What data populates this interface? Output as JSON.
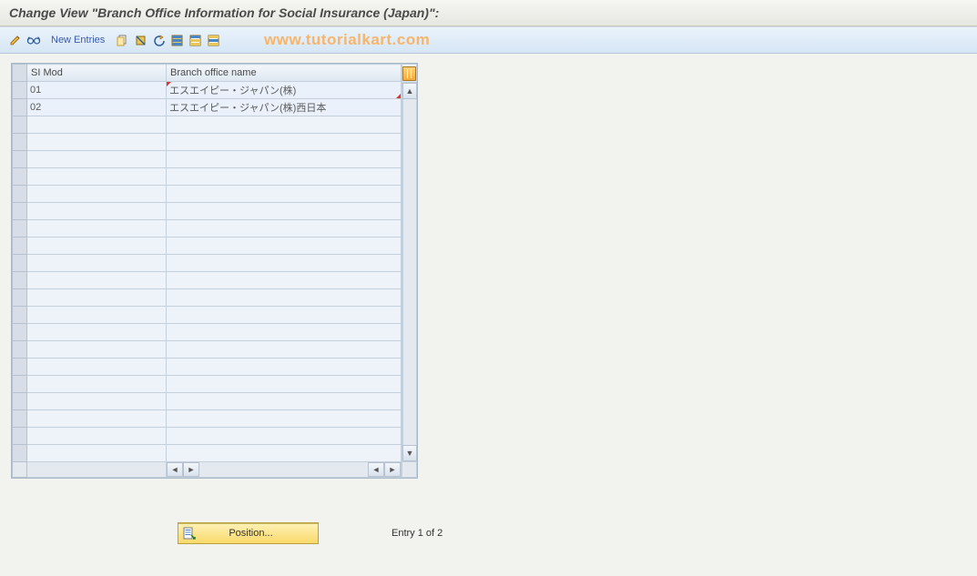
{
  "title": "Change View \"Branch Office Information for Social Insurance (Japan)\":",
  "toolbar": {
    "new_entries_label": "New Entries",
    "icons": {
      "toggle": "toggle-edit-icon",
      "other_view": "glasses-icon",
      "copy": "copy-icon",
      "delete": "delete-icon",
      "undo": "undo-icon",
      "select_all": "select-all-icon",
      "deselect_all": "deselect-all-icon",
      "table_settings": "table-settings-icon"
    }
  },
  "watermark": "www.tutorialkart.com",
  "table": {
    "columns": [
      "SI Mod",
      "Branch office name"
    ],
    "rows": [
      {
        "si_mod": "01",
        "branch_name": "エスエイピー・ジャパン(株)"
      },
      {
        "si_mod": "02",
        "branch_name": "エスエイピー・ジャパン(株)西日本"
      }
    ],
    "visible_row_count": 22
  },
  "footer": {
    "position_label": "Position...",
    "entry_text": "Entry 1 of 2"
  }
}
